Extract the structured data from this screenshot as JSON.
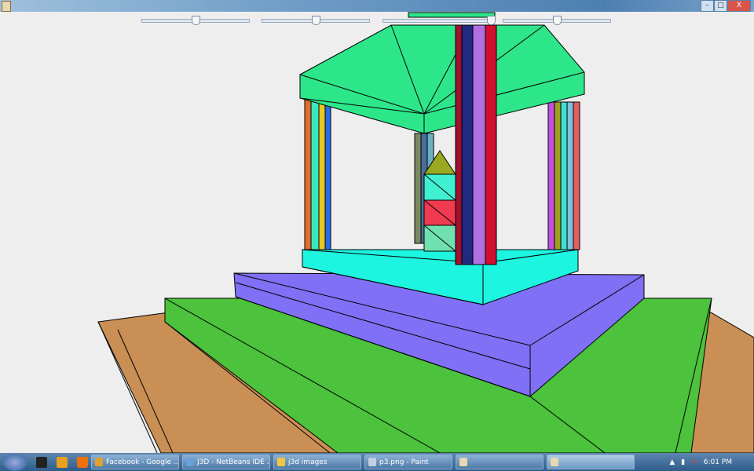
{
  "window": {
    "minimize": "–",
    "maximize": "□",
    "close": "X"
  },
  "sliders": [
    {
      "name": "slider-1",
      "value": 0.5
    },
    {
      "name": "slider-2",
      "value": 0.5
    },
    {
      "name": "slider-3",
      "value": 1.0
    },
    {
      "name": "slider-4",
      "value": 0.5
    }
  ],
  "taskbar": {
    "tasks": [
      {
        "label": "Facebook - Google ...",
        "color": "#e0a030"
      },
      {
        "label": "J3D - NetBeans IDE ...",
        "color": "#6aa0d8"
      },
      {
        "label": "j3d images",
        "color": "#f0c840"
      },
      {
        "label": "p3.png - Paint",
        "color": "#c0d0e0"
      },
      {
        "label": "",
        "color": "#e9d7b0"
      },
      {
        "label": "",
        "color": "#e9d7b0"
      }
    ],
    "clock": "6:01 PM"
  },
  "colors": {
    "brown": "#c98f55",
    "green": "#4cc23d",
    "purple": "#7f70f5",
    "cyan": "#1ef5e0",
    "roof": "#2ee68a"
  }
}
